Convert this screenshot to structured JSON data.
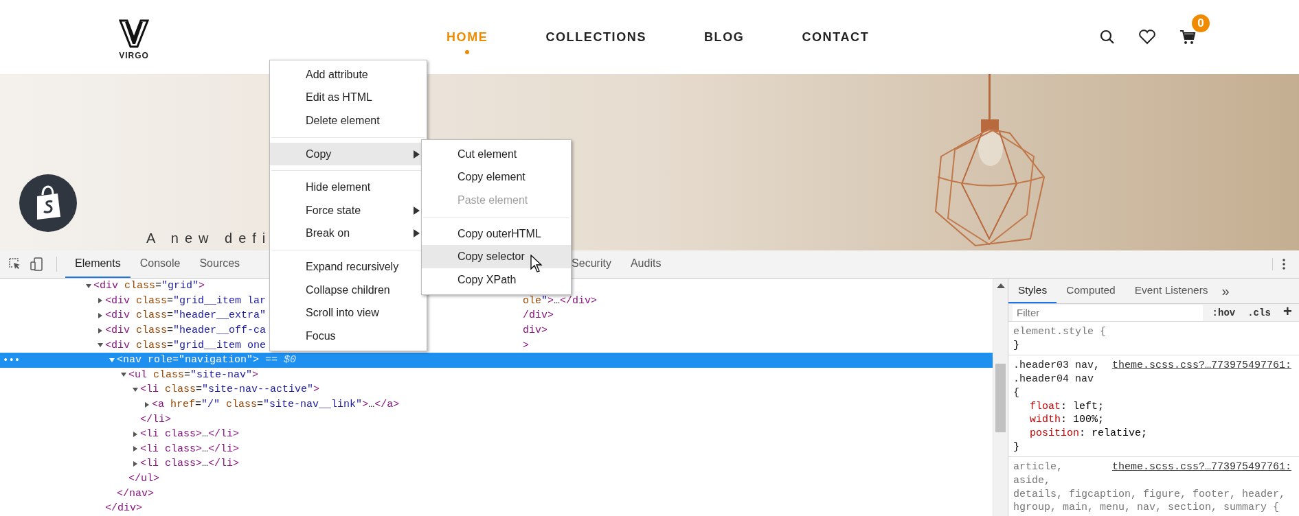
{
  "header": {
    "logo": {
      "text": "VIRGO"
    },
    "nav": [
      {
        "label": "HOME",
        "selected": true
      },
      {
        "label": "COLLECTIONS",
        "selected": false
      },
      {
        "label": "BLOG",
        "selected": false
      },
      {
        "label": "CONTACT",
        "selected": false
      }
    ],
    "cart_count": "0"
  },
  "hero": {
    "kind": "picture",
    "tagline": "A new defi"
  },
  "devtools": {
    "tabs": [
      {
        "label": "Elements",
        "selected": true
      },
      {
        "label": "Console",
        "selected": false
      },
      {
        "label": "Sources",
        "selected": false
      },
      {
        "label": "Security",
        "selected": false
      },
      {
        "label": "Audits",
        "selected": false
      }
    ],
    "tree": [
      {
        "text": "<div class=\"grid\">",
        "expanded": true,
        "selected": false,
        "children": [
          {
            "text": "<div class=\"grid__item lar",
            "after": "ole\">…</div>",
            "expanded": false,
            "selected": false
          },
          {
            "text": "<div class=\"header__extra\"",
            "after": "/div>",
            "expanded": false,
            "selected": false
          },
          {
            "text": "<div class=\"header__off-ca",
            "after": "div>",
            "expanded": false,
            "selected": false
          },
          {
            "text": "<div class=\"grid__item one",
            "after": ">",
            "expanded": true,
            "selected": false,
            "close": "</div>",
            "children": [
              {
                "text": "<nav role=\"navigation\">",
                "suffix": "== $0",
                "dots": "•••",
                "expanded": true,
                "selected": true,
                "close": "</nav>",
                "children": [
                  {
                    "text": "<ul class=\"site-nav\">",
                    "expanded": true,
                    "selected": false,
                    "close": "</ul>",
                    "children": [
                      {
                        "text": "<li class=\"site-nav--active\">",
                        "expanded": true,
                        "selected": false,
                        "close": "</li>",
                        "children": [
                          {
                            "text": "<a href=\"/\" class=\"site-nav__link\">…</a>",
                            "expanded": false,
                            "selected": false
                          }
                        ]
                      },
                      {
                        "text": "<li class>…</li>",
                        "expanded": false,
                        "selected": false
                      },
                      {
                        "text": "<li class>…</li>",
                        "expanded": false,
                        "selected": false
                      },
                      {
                        "text": "<li class>…</li>",
                        "expanded": false,
                        "selected": false
                      }
                    ]
                  }
                ]
              }
            ]
          }
        ]
      }
    ],
    "styles": {
      "tabs": [
        {
          "label": "Styles",
          "selected": true
        },
        {
          "label": "Computed",
          "selected": false
        },
        {
          "label": "Event Listeners",
          "selected": false
        }
      ],
      "more": "»",
      "filter": {
        "placeholder": "Filter"
      },
      "buttons": [
        ":hov",
        ".cls",
        "+"
      ],
      "colon": ":",
      "rules": [
        {
          "selectors": [
            "element.style {"
          ],
          "dimmed": true,
          "end": "}"
        },
        {
          "selectors": [
            ".header03 nav,",
            ".header04 nav",
            "{"
          ],
          "source": "theme.scss.css?…773975497761:",
          "dimmed": false,
          "properties": [
            {
              "name": "float",
              "value": "left;"
            },
            {
              "name": "width",
              "value": "100%;"
            },
            {
              "name": "position",
              "value": "relative;"
            }
          ],
          "end": "}"
        },
        {
          "selectors": [
            "article,",
            "aside,",
            "details, figcaption, figure, footer, header,",
            "hgroup, main, menu, nav, section, summary {"
          ],
          "source": "theme.scss.css?…773975497761:",
          "dimmed": true
        }
      ]
    }
  },
  "context_menu": {
    "groups": [
      [
        {
          "label": "Add attribute",
          "submenu": false,
          "selected": false
        },
        {
          "label": "Edit as HTML",
          "submenu": false,
          "selected": false
        },
        {
          "label": "Delete element",
          "submenu": false,
          "selected": false
        }
      ],
      [
        {
          "label": "Copy",
          "submenu": true,
          "selected": true
        }
      ],
      [
        {
          "label": "Hide element",
          "submenu": false,
          "selected": false
        },
        {
          "label": "Force state",
          "submenu": true,
          "selected": false
        },
        {
          "label": "Break on",
          "submenu": true,
          "selected": false
        }
      ],
      [
        {
          "label": "Expand recursively",
          "submenu": false,
          "selected": false
        },
        {
          "label": "Collapse children",
          "submenu": false,
          "selected": false
        },
        {
          "label": "Scroll into view",
          "submenu": false,
          "selected": false
        },
        {
          "label": "Focus",
          "submenu": false,
          "selected": false
        }
      ]
    ]
  },
  "submenu": {
    "groups": [
      [
        {
          "label": "Cut element",
          "disabled": false,
          "selected": false
        },
        {
          "label": "Copy element",
          "disabled": false,
          "selected": false
        },
        {
          "label": "Paste element",
          "disabled": true,
          "selected": false
        }
      ],
      [
        {
          "label": "Copy outerHTML",
          "disabled": false,
          "selected": false
        },
        {
          "label": "Copy selector",
          "disabled": false,
          "selected": true
        },
        {
          "label": "Copy XPath",
          "disabled": false,
          "selected": false
        }
      ]
    ]
  }
}
